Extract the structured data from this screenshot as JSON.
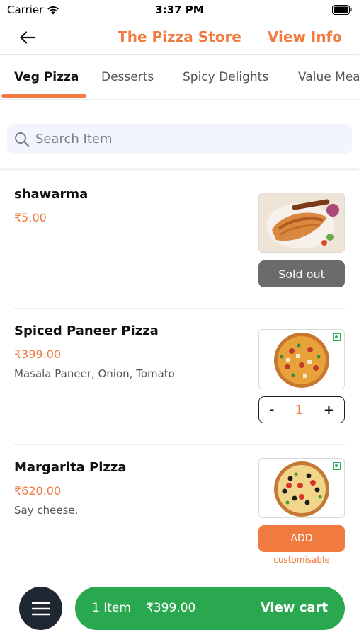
{
  "status": {
    "carrier": "Carrier",
    "time": "3:37 PM"
  },
  "header": {
    "title": "The Pizza Store",
    "action": "View Info"
  },
  "tabs": [
    {
      "label": "Veg Pizza",
      "active": true
    },
    {
      "label": "Desserts"
    },
    {
      "label": "Spicy Delights"
    },
    {
      "label": "Value Meals"
    }
  ],
  "search": {
    "placeholder": "Search Item"
  },
  "items": [
    {
      "name": "shawarma",
      "price": "₹5.00",
      "description": "",
      "action": "Sold out"
    },
    {
      "name": "Spiced Paneer Pizza",
      "price": "₹399.00",
      "description": "Masala Paneer, Onion, Tomato",
      "stepper": {
        "minus": "-",
        "quantity": "1",
        "plus": "+"
      }
    },
    {
      "name": "Margarita Pizza",
      "price": "₹620.00",
      "description": "Say cheese.",
      "action": "ADD",
      "note": "customisable"
    }
  ],
  "cart": {
    "count_label": "1 Item",
    "total": "₹399.00",
    "action": "View cart"
  },
  "colors": {
    "accent": "#f07a3f",
    "cart_green": "#2aa84f",
    "fab_dark": "#1f2733",
    "sold_out_grey": "#6b6b6b",
    "veg_green": "#2db35d"
  }
}
